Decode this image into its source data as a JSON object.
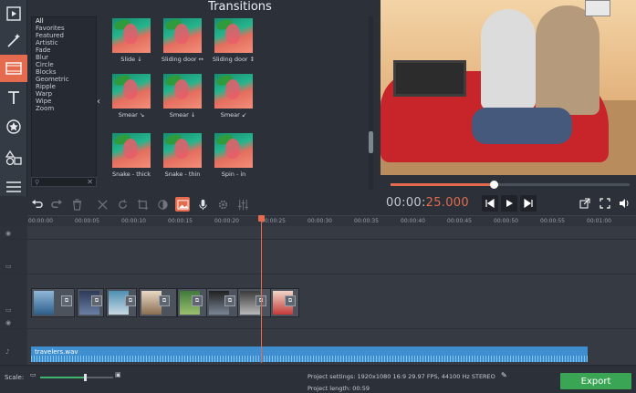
{
  "panel": {
    "title": "Transitions"
  },
  "categories": [
    "All",
    "Favorites",
    "Featured",
    "Artistic",
    "Fade",
    "Blur",
    "Circle",
    "Blocks",
    "Geometric",
    "Ripple",
    "Warp",
    "Wipe",
    "Zoom"
  ],
  "tiles": [
    {
      "label": "Slide ↓"
    },
    {
      "label": "Sliding door ↔"
    },
    {
      "label": "Sliding door ↕"
    },
    {
      "label": "Smear ↘"
    },
    {
      "label": "Smear ↓"
    },
    {
      "label": "Smear ↙"
    },
    {
      "label": "Snake - thick"
    },
    {
      "label": "Snake - thin"
    },
    {
      "label": "Spin - in"
    }
  ],
  "player": {
    "timecode_prefix": "00:00:",
    "timecode_hl": "25.000",
    "progress": 0.43
  },
  "ruler": [
    "00:00:00",
    "00:00:05",
    "00:00:10",
    "00:00:15",
    "00:00:20",
    "00:00:25",
    "00:00:30",
    "00:00:35",
    "00:00:40",
    "00:00:45",
    "00:00:50",
    "00:00:55",
    "00:01:00"
  ],
  "audio": {
    "name": "travelers.wav"
  },
  "status": {
    "scale_label": "Scale:",
    "scale_value": 0.6,
    "project_settings": "Project settings:  1920x1080 16:9 29.97 FPS, 44100 Hz STEREO",
    "project_length": "Project length:    00:59",
    "export_label": "Export"
  },
  "icons": {
    "tools": [
      "video-import-icon",
      "magic-wand-icon",
      "filters-icon",
      "titles-icon",
      "stickers-icon",
      "shapes-icon",
      "transitions-list-icon"
    ],
    "toolbar": [
      "undo-icon",
      "redo-icon",
      "delete-icon",
      "cut-icon",
      "rotate-icon",
      "crop-icon",
      "color-adjust-icon",
      "media-icon",
      "microphone-icon",
      "settings-icon",
      "equalizer-icon"
    ]
  },
  "colors": {
    "accent": "#e46b4d",
    "export": "#3aa655",
    "audio": "#3f8fd0"
  }
}
